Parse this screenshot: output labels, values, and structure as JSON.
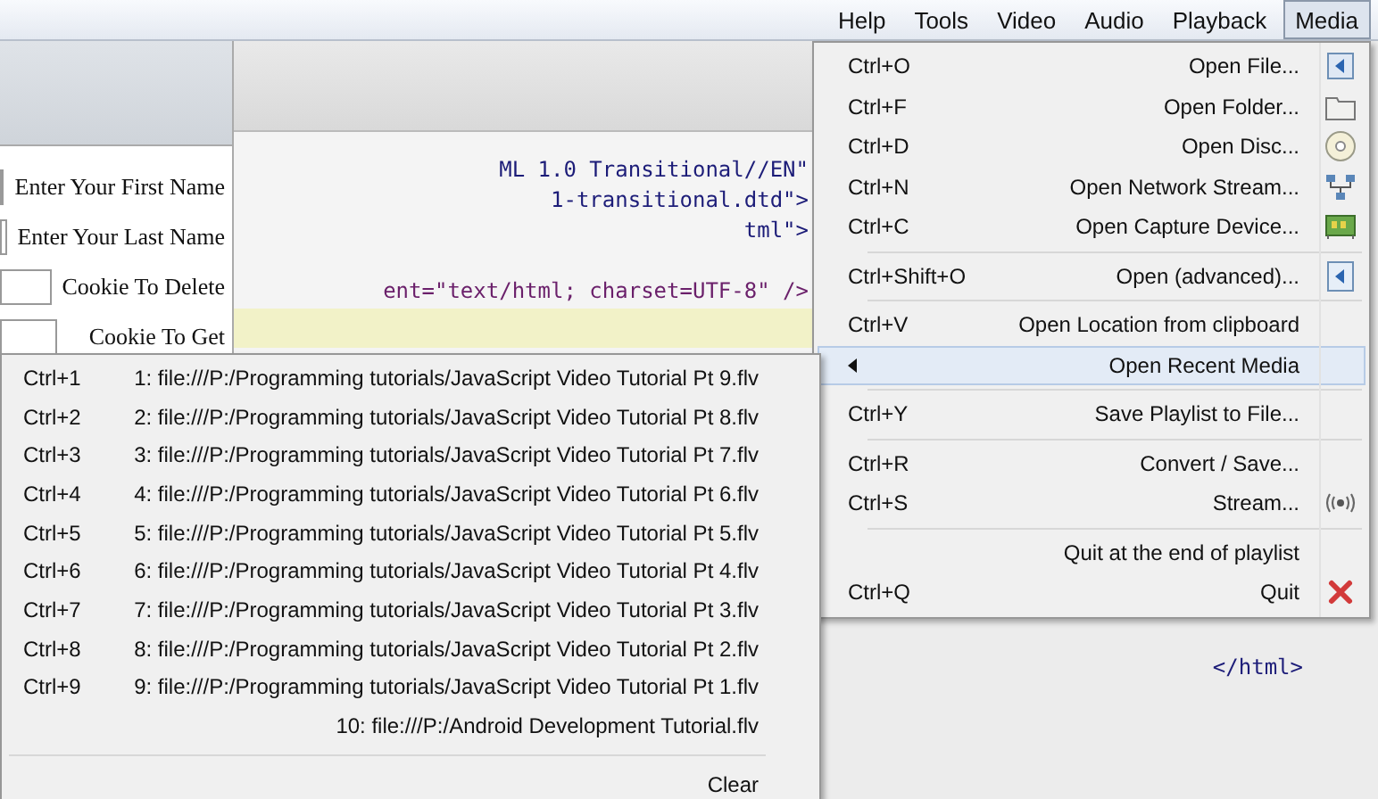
{
  "menubar": [
    {
      "label": "Help",
      "selected": false
    },
    {
      "label": "Tools",
      "selected": false
    },
    {
      "label": "Video",
      "selected": false
    },
    {
      "label": "Audio",
      "selected": false
    },
    {
      "label": "Playback",
      "selected": false
    },
    {
      "label": "Media",
      "selected": true
    }
  ],
  "browser": {
    "fields": [
      {
        "label": "Enter Your First Name"
      },
      {
        "label": "Enter Your Last Name"
      },
      {
        "label": "Cookie To Delete"
      },
      {
        "label": "Cookie To Get"
      }
    ]
  },
  "editor": {
    "lines": [
      "ML 1.0 Transitional//EN\"",
      "1-transitional.dtd\">",
      "tml\">",
      "ent=\"text/html; charset=UTF-8\" />"
    ],
    "tail_lines": [
      "</html>"
    ]
  },
  "media_menu": [
    {
      "kind": "item",
      "label": "Open File...",
      "shortcut": "Ctrl+O",
      "has_submenu": false,
      "selected": false
    },
    {
      "kind": "item",
      "label": "Open Folder...",
      "shortcut": "Ctrl+F",
      "has_submenu": false,
      "selected": false
    },
    {
      "kind": "item",
      "label": "Open Disc...",
      "shortcut": "Ctrl+D",
      "has_submenu": false,
      "selected": false
    },
    {
      "kind": "item",
      "label": "Open Network Stream...",
      "shortcut": "Ctrl+N",
      "has_submenu": false,
      "selected": false
    },
    {
      "kind": "item",
      "label": "Open Capture Device...",
      "shortcut": "Ctrl+C",
      "has_submenu": false,
      "selected": false
    },
    {
      "kind": "separator"
    },
    {
      "kind": "item",
      "label": "Open (advanced)...",
      "shortcut": "Ctrl+Shift+O",
      "has_submenu": false,
      "selected": false
    },
    {
      "kind": "separator"
    },
    {
      "kind": "item",
      "label": "Open Location from clipboard",
      "shortcut": "Ctrl+V",
      "has_submenu": false,
      "selected": false
    },
    {
      "kind": "item",
      "label": "Open Recent Media",
      "has_submenu": true,
      "selected": true
    },
    {
      "kind": "separator"
    },
    {
      "kind": "item",
      "label": "Save Playlist to File...",
      "shortcut": "Ctrl+Y",
      "has_submenu": false,
      "selected": false
    },
    {
      "kind": "separator"
    },
    {
      "kind": "item",
      "label": "Convert / Save...",
      "shortcut": "Ctrl+R",
      "has_submenu": false,
      "selected": false
    },
    {
      "kind": "item",
      "label": "Stream...",
      "shortcut": "Ctrl+S",
      "has_submenu": false,
      "selected": false
    },
    {
      "kind": "separator"
    },
    {
      "kind": "item",
      "label": "Quit at the end of playlist",
      "has_submenu": false,
      "selected": false
    },
    {
      "kind": "item",
      "label": "Quit",
      "shortcut": "Ctrl+Q",
      "has_submenu": false,
      "selected": false
    }
  ],
  "recent_menu": [
    {
      "kind": "item",
      "label": "1: file:///P:/Programming tutorials/JavaScript Video Tutorial Pt 9.flv",
      "shortcut": "Ctrl+1"
    },
    {
      "kind": "item",
      "label": "2: file:///P:/Programming tutorials/JavaScript Video Tutorial Pt 8.flv",
      "shortcut": "Ctrl+2"
    },
    {
      "kind": "item",
      "label": "3: file:///P:/Programming tutorials/JavaScript Video Tutorial Pt 7.flv",
      "shortcut": "Ctrl+3"
    },
    {
      "kind": "item",
      "label": "4: file:///P:/Programming tutorials/JavaScript Video Tutorial Pt 6.flv",
      "shortcut": "Ctrl+4"
    },
    {
      "kind": "item",
      "label": "5: file:///P:/Programming tutorials/JavaScript Video Tutorial Pt 5.flv",
      "shortcut": "Ctrl+5"
    },
    {
      "kind": "item",
      "label": "6: file:///P:/Programming tutorials/JavaScript Video Tutorial Pt 4.flv",
      "shortcut": "Ctrl+6"
    },
    {
      "kind": "item",
      "label": "7: file:///P:/Programming tutorials/JavaScript Video Tutorial Pt 3.flv",
      "shortcut": "Ctrl+7"
    },
    {
      "kind": "item",
      "label": "8: file:///P:/Programming tutorials/JavaScript Video Tutorial Pt 2.flv",
      "shortcut": "Ctrl+8"
    },
    {
      "kind": "item",
      "label": "9: file:///P:/Programming tutorials/JavaScript Video Tutorial Pt 1.flv",
      "shortcut": "Ctrl+9"
    },
    {
      "kind": "item",
      "label": "10: file:///P:/Android Development Tutorial.flv"
    },
    {
      "kind": "separator"
    },
    {
      "kind": "item",
      "label": "Clear"
    }
  ]
}
